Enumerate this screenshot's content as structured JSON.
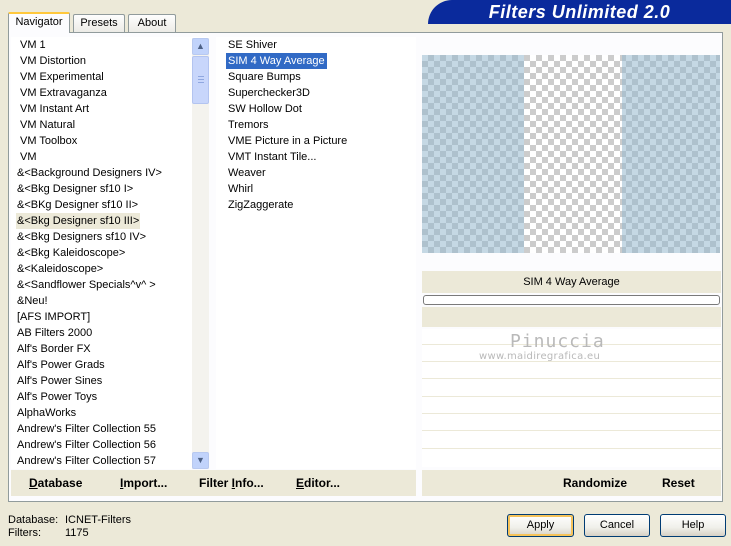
{
  "tabs": [
    {
      "label": "Navigator",
      "active": true
    },
    {
      "label": "Presets",
      "active": false
    },
    {
      "label": "About",
      "active": false
    }
  ],
  "banner": {
    "title": "Filters Unlimited 2.0"
  },
  "categories": {
    "items": [
      "VM 1",
      "VM Distortion",
      "VM Experimental",
      "VM Extravaganza",
      "VM Instant Art",
      "VM Natural",
      "VM Toolbox",
      "VM",
      "&<Background Designers IV>",
      "&<Bkg Designer sf10 I>",
      "&<BKg Designer sf10 II>",
      "&<Bkg Designer sf10 III>",
      "&<Bkg Designers sf10 IV>",
      "&<Bkg Kaleidoscope>",
      "&<Kaleidoscope>",
      "&<Sandflower Specials^v^ >",
      "&Neu!",
      "[AFS IMPORT]",
      "AB Filters 2000",
      "Alf's Border FX",
      "Alf's Power Grads",
      "Alf's Power Sines",
      "Alf's Power Toys",
      "AlphaWorks",
      "Andrew's Filter Collection 55",
      "Andrew's Filter Collection 56",
      "Andrew's Filter Collection 57"
    ],
    "selected": "&<Bkg Designer sf10 III>"
  },
  "filters": {
    "items": [
      "SE Shiver",
      "SIM 4 Way Average",
      "Square Bumps",
      "Superchecker3D",
      "SW Hollow Dot",
      "Tremors",
      "VME Picture in a Picture",
      "VMT Instant Tile...",
      "Weaver",
      "Whirl",
      "ZigZaggerate"
    ],
    "selected": "SIM 4 Way Average"
  },
  "preview": {
    "filter_name": "SIM 4 Way Average",
    "progress": 0,
    "watermark_name": "Pinuccia",
    "watermark_url": "www.maidiregrafica.eu"
  },
  "toolbar": {
    "database_first": "D",
    "database_rest": "atabase",
    "import_first": "I",
    "import_rest": "mport...",
    "filterinfo_prefix": "Filter ",
    "filterinfo_ul": "I",
    "filterinfo_rest": "nfo...",
    "editor_first": "E",
    "editor_rest": "ditor...",
    "randomize": "Randomize",
    "reset": "Reset"
  },
  "status": {
    "database_label": "Database:",
    "database_value": "ICNET-Filters",
    "filters_label": "Filters:",
    "filters_value": "1175"
  },
  "buttons": {
    "apply": "Apply",
    "cancel": "Cancel",
    "help": "Help"
  },
  "colors": {
    "banner": "#0a2a9c",
    "selection": "#316ac5",
    "preview_tint": "#96b8ce",
    "window_bg": "#ece9d8"
  }
}
